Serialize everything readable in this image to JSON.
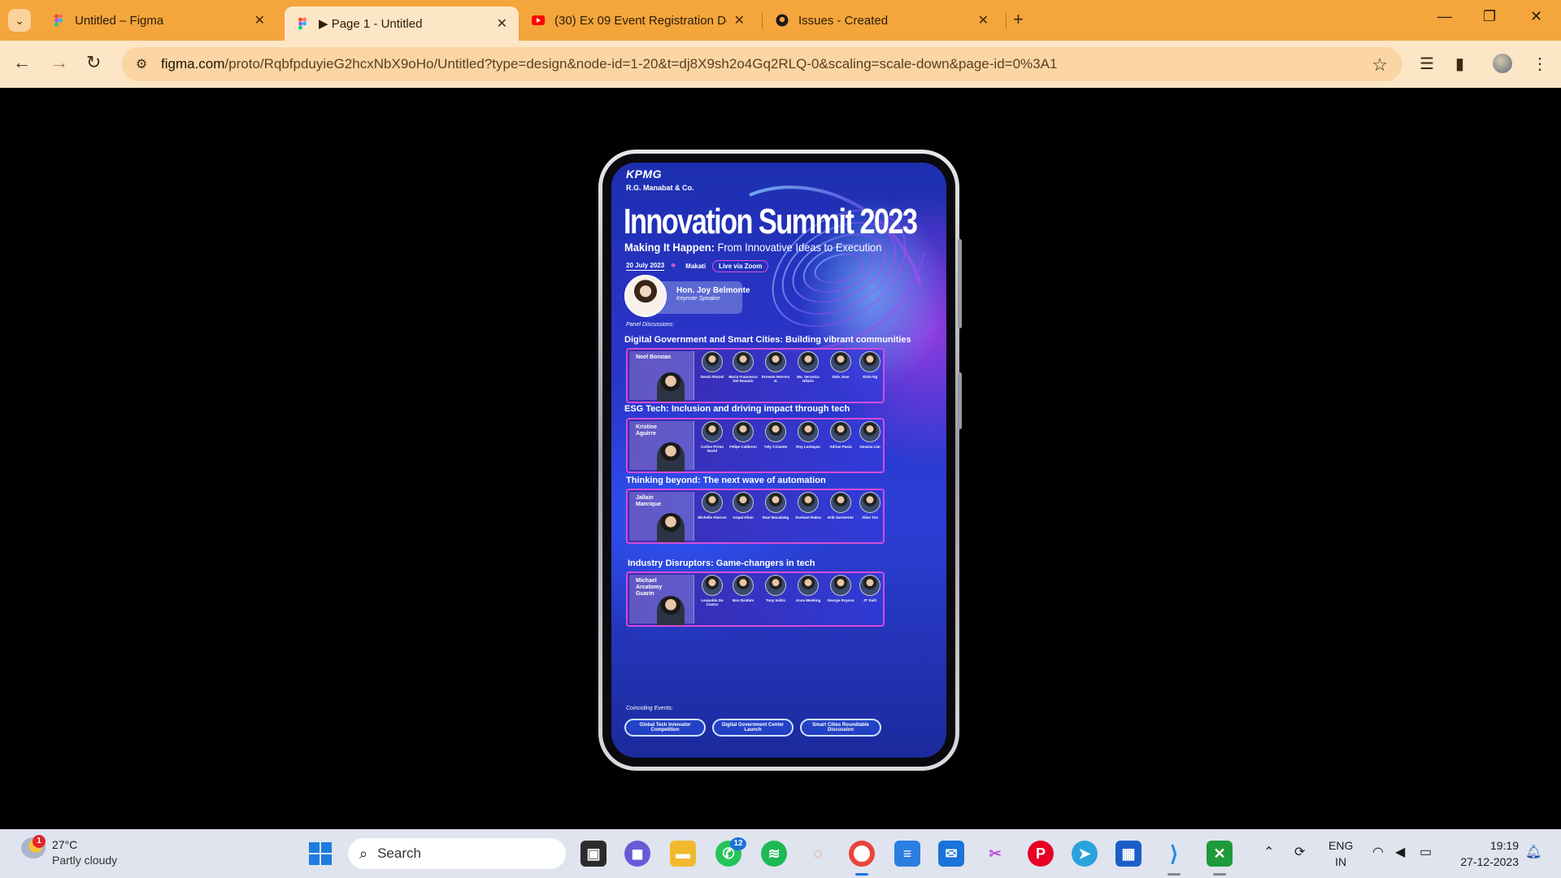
{
  "browser": {
    "tabs": [
      {
        "title": "Untitled – Figma",
        "active": false
      },
      {
        "title": "▶ Page 1 - Untitled",
        "active": true
      },
      {
        "title": "(30) Ex 09 Event Registration De",
        "active": false
      },
      {
        "title": "Issues - Created",
        "active": false
      }
    ],
    "url_domain": "figma.com",
    "url_path": "/proto/RqbfpduyieG2hcxNbX9oHo/Untitled?type=design&node-id=1-20&t=dj8X9sh2o4Gq2RLQ-0&scaling=scale-down&page-id=0%3A1"
  },
  "poster": {
    "logo": "KPMG",
    "firm": "R.G. Manabat & Co.",
    "headline": "Innovation Summit 2023",
    "subline_bold": "Making It Happen:",
    "subline_rest": " From Innovative Ideas to Execution",
    "date": "20 July 2023",
    "location": "Makati",
    "live": "Live via Zoom",
    "keynote_name": "Hon. Joy Belmonte",
    "keynote_role": "Keynote Speaker",
    "panel_heading": "Panel Discussions:",
    "panels": [
      {
        "title": "Digital Government and Smart Cities: Building vibrant communities",
        "moderator": "Noel Bonoan",
        "speakers": [
          "David Almirol",
          "Maria Francesca Del Rosario",
          "Ernesto Herrera Jr.",
          "Ma. Veronica Hilario",
          "Dale Jose",
          "Alvin Ng"
        ]
      },
      {
        "title": "ESG Tech: Inclusion and driving impact through tech",
        "moderator": "Kristine Aguirre",
        "speakers": [
          "Carlos Primo David",
          "Felipe Calderon",
          "Yoly Crisanto",
          "Roy Luntayao",
          "Adrian Pacia",
          "Umaisa Lim"
        ]
      },
      {
        "title": "Thinking beyond: The next wave of automation",
        "moderator": "Jallain Manrique",
        "speakers": [
          "Michelle Alarcon",
          "Gopal Khan",
          "Raul Macalalag",
          "Sushant Rabra",
          "Erik Sarmiento",
          "Allan Tan"
        ]
      },
      {
        "title": "Industry Disruptors: Game-changers in tech",
        "moderator": "Michael Arcatomy Guarin",
        "speakers": [
          "Leopoldo De Castro",
          "Bon Ibrahim",
          "Tony Isidro",
          "Anna Meeking",
          "George Royeca",
          "JT Sulit"
        ]
      }
    ],
    "coinciding_heading": "Coinciding Events:",
    "events": [
      "Global Tech Innovator Competition",
      "Digital Government Center Launch",
      "Smart Cities Roundtable Discussion"
    ]
  },
  "taskbar": {
    "weather_badge": "1",
    "temperature": "27°C",
    "condition": "Partly cloudy",
    "search_placeholder": "Search",
    "whatsapp_badge": "12",
    "lang_line1": "ENG",
    "lang_line2": "IN",
    "time": "19:19",
    "date": "27-12-2023"
  }
}
